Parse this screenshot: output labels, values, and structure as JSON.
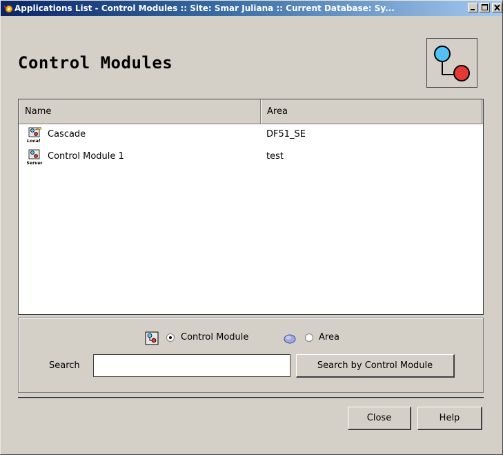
{
  "window": {
    "title": "Applications List - Control Modules :: Site: Smar Juliana :: Current Database: Sy..."
  },
  "header": {
    "title": "Control Modules",
    "logo_icon": "control-module-logo-icon"
  },
  "list": {
    "columns": [
      "Name",
      "Area"
    ],
    "rows": [
      {
        "name": "Cascade",
        "area": "DF51_SE",
        "icon": "local-control-module-icon",
        "icon_tag": "Local"
      },
      {
        "name": "Control Module 1",
        "area": "test",
        "icon": "server-control-module-icon",
        "icon_tag": "Server"
      }
    ]
  },
  "search": {
    "options": [
      {
        "label": "Control Module",
        "selected": true,
        "icon": "control-module-icon"
      },
      {
        "label": "Area",
        "selected": false,
        "icon": "area-icon"
      }
    ],
    "label": "Search",
    "value": "",
    "button_label": "Search by Control Module"
  },
  "footer": {
    "close_label": "Close",
    "help_label": "Help"
  },
  "colors": {
    "window_bg": "#d4d0c8",
    "title_gradient_start": "#0a246a",
    "title_gradient_end": "#a6caf0",
    "logo_cyan": "#4fc3f7",
    "logo_red": "#e53935"
  }
}
